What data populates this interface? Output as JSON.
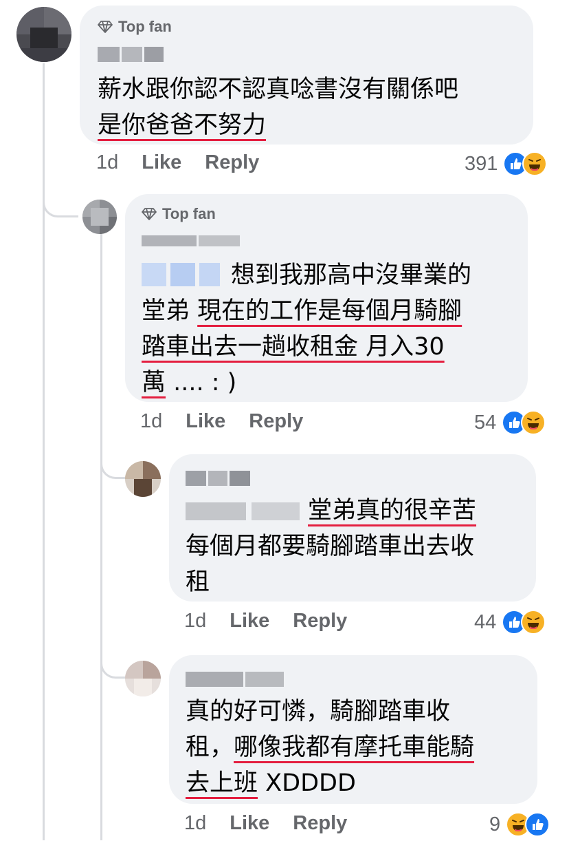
{
  "badge": "Top fan",
  "comments": [
    {
      "line1": "薪水跟你認不認真唸書沒有關係吧",
      "line2": "是你爸爸不努力",
      "time": "1d",
      "like": "Like",
      "reply": "Reply",
      "reactions": "391"
    },
    {
      "line1": "想到我那高中沒畢業的",
      "line2_plain": "堂弟 ",
      "line2_ul": "現在的工作是每個月騎腳",
      "line3_ul": "踏車出去一趟收租金 月入30",
      "line4_ul": "萬",
      "line4_rest": " ....  : )",
      "time": "1d",
      "like": "Like",
      "reply": "Reply",
      "reactions": "54"
    },
    {
      "line1_ul": "堂弟真的很辛苦",
      "line2": "每個月都要騎腳踏車出去收",
      "line3": "租",
      "time": "1d",
      "like": "Like",
      "reply": "Reply",
      "reactions": "44"
    },
    {
      "line1": "真的好可憐，騎腳踏車收",
      "line2_plain": "租，",
      "line2_ul": "哪像我都有摩托車能騎",
      "line3_ul": "去上班",
      "line3_rest": " XDDDD",
      "time": "1d",
      "like": "Like",
      "reply": "Reply",
      "reactions": "9"
    }
  ],
  "colors": {
    "bubble": "#f0f2f5",
    "meta": "#65676b",
    "underline": "#e41e3f",
    "like": "#1877f2",
    "haha": "#f7b125"
  },
  "icons": [
    "diamond-icon",
    "like-reaction-icon",
    "haha-reaction-icon"
  ]
}
